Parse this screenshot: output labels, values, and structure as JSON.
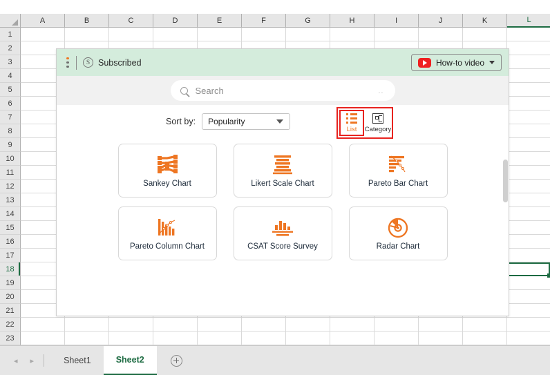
{
  "spreadsheet": {
    "columns": [
      "A",
      "B",
      "C",
      "D",
      "E",
      "F",
      "G",
      "H",
      "I",
      "J",
      "K",
      "L"
    ],
    "active_column": "L",
    "rows": [
      1,
      2,
      3,
      4,
      5,
      6,
      7,
      8,
      9,
      10,
      11,
      12,
      13,
      14,
      15,
      16,
      17,
      18,
      19,
      20,
      21,
      22,
      23
    ],
    "active_row": 18,
    "active_cell": "L18",
    "selection_color": "#1d6b42",
    "sheet_tabs": [
      {
        "name": "Sheet1",
        "active": false
      },
      {
        "name": "Sheet2",
        "active": true
      }
    ],
    "add_sheet_label": "+",
    "nav_prev": "◂",
    "nav_next": "▸"
  },
  "panel": {
    "header": {
      "subscribed_label": "Subscribed",
      "subscribed_badge": "S",
      "howto_label": "How-to video",
      "background_color": "#d4ecdc"
    },
    "search": {
      "placeholder": "Search",
      "value": "",
      "trailing_dots": ".."
    },
    "toolbar": {
      "sort_label": "Sort by:",
      "sort_value": "Popularity",
      "sort_options": [
        "Popularity"
      ],
      "view_modes": [
        {
          "label": "List",
          "active": true
        },
        {
          "label": "Category",
          "active": false
        }
      ],
      "highlight_color": "#e8231f",
      "accent_color": "#ee7623"
    },
    "cards": [
      {
        "label": "Sankey Chart",
        "icon": "sankey-chart-icon"
      },
      {
        "label": "Likert Scale Chart",
        "icon": "likert-scale-chart-icon"
      },
      {
        "label": "Pareto Bar Chart",
        "icon": "pareto-bar-chart-icon"
      },
      {
        "label": "Pareto Column Chart",
        "icon": "pareto-column-chart-icon"
      },
      {
        "label": "CSAT Score Survey",
        "icon": "csat-score-survey-icon"
      },
      {
        "label": "Radar Chart",
        "icon": "radar-chart-icon"
      }
    ]
  }
}
